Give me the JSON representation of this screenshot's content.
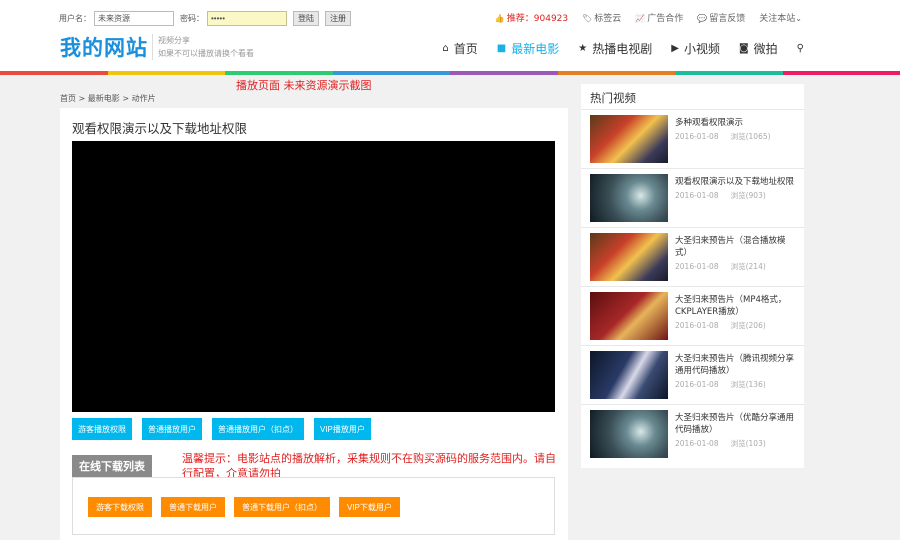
{
  "login": {
    "username_label": "用户名：",
    "username_value": "未来资源",
    "password_label": "密码：",
    "password_value": "•••••",
    "login_button": "登陆",
    "register_button": "注册"
  },
  "top_links": {
    "recommend": "推荐：904923",
    "tags": "标签云",
    "ads": "广告合作",
    "feedback": "留言反馈",
    "about": "关注本站"
  },
  "logo": "我的网站",
  "slogan": {
    "line1": "视频分享",
    "line2": "如果不可以播放请换个看看"
  },
  "nav": [
    {
      "label": "首页",
      "icon": "home-icon"
    },
    {
      "label": "最新电影",
      "icon": "video-camera-icon"
    },
    {
      "label": "热播电视剧",
      "icon": "star-icon"
    },
    {
      "label": "小视频",
      "icon": "play-square-icon"
    },
    {
      "label": "微拍",
      "icon": "camera-icon"
    },
    {
      "label": "",
      "icon": "search-icon"
    }
  ],
  "promo": "播放页面    未来资源演示截图",
  "breadcrumb": "首页 > 最新电影 > 动作片",
  "main": {
    "title": "观看权限演示以及下载地址权限",
    "play_buttons": [
      "游客播放权限",
      "普通播放用户",
      "普通播放用户（扣点）",
      "VIP播放用户"
    ],
    "download_tab": "在线下载列表",
    "tip": "温馨提示：电影站点的播放解析，采集规则不在购买源码的服务范围内。请自行配置，介意请勿拍",
    "download_buttons": [
      "游客下载权限",
      "普通下载用户",
      "普通下载用户（扣点）",
      "VIP下载用户"
    ]
  },
  "sidebar": {
    "title": "热门视频",
    "items": [
      {
        "title": "多种观看权限演示",
        "date": "2016-01-08",
        "views": "浏览(1065)",
        "thumb": "t1"
      },
      {
        "title": "观看权限演示以及下载地址权限",
        "date": "2016-01-08",
        "views": "浏览(903)",
        "thumb": "t2"
      },
      {
        "title": "大圣归来预告片（混合播放模式）",
        "date": "2016-01-08",
        "views": "浏览(214)",
        "thumb": "t1"
      },
      {
        "title": "大圣归来预告片（MP4格式，CKPLAYER播放）",
        "date": "2016-01-08",
        "views": "浏览(206)",
        "thumb": "t3"
      },
      {
        "title": "大圣归来预告片（腾讯视频分享通用代码播放）",
        "date": "2016-01-08",
        "views": "浏览(136)",
        "thumb": "t4"
      },
      {
        "title": "大圣归来预告片（优酷分享通用代码播放）",
        "date": "2016-01-08",
        "views": "浏览(103)",
        "thumb": "t2"
      }
    ]
  }
}
